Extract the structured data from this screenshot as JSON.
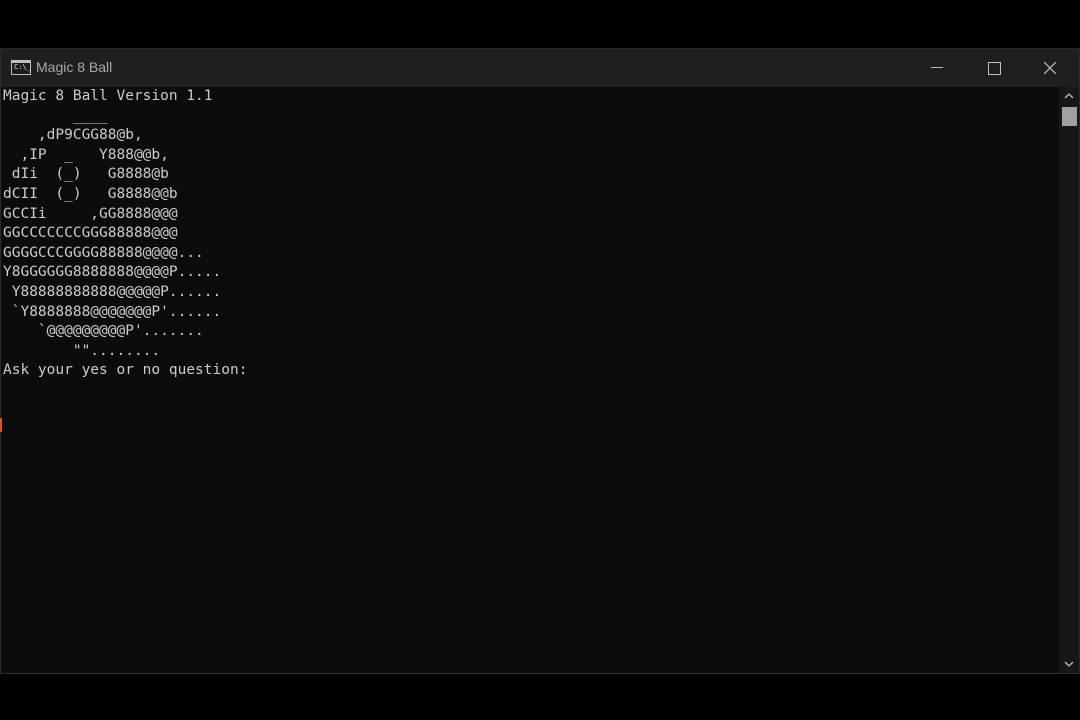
{
  "window": {
    "title": "Magic 8 Ball",
    "icon": "console-icon",
    "icon_text": "C:\\_"
  },
  "controls": {
    "minimize": "minimize-icon",
    "maximize": "maximize-icon",
    "close": "close-icon"
  },
  "console": {
    "lines": [
      "Magic 8 Ball Version 1.1",
      "        ____",
      "    ,dP9CGG88@b,",
      "  ,IP  _   Y888@@b,",
      " dIi  (_)   G8888@b",
      "dCII  (_)   G8888@@b",
      "GCCIi     ,GG8888@@@",
      "GGCCCCCCCGGG88888@@@",
      "GGGGCCCGGGG88888@@@@...",
      "Y8GGGGGG8888888@@@@P.....",
      " Y88888888888@@@@@P......",
      " `Y8888888@@@@@@@P'......",
      "    `@@@@@@@@@P'.......",
      "        \"\"........",
      "Ask your yes or no question: "
    ]
  },
  "colors": {
    "background": "#0c0c0c",
    "text": "#cccccc",
    "titlebar": "#1f1f1f"
  }
}
